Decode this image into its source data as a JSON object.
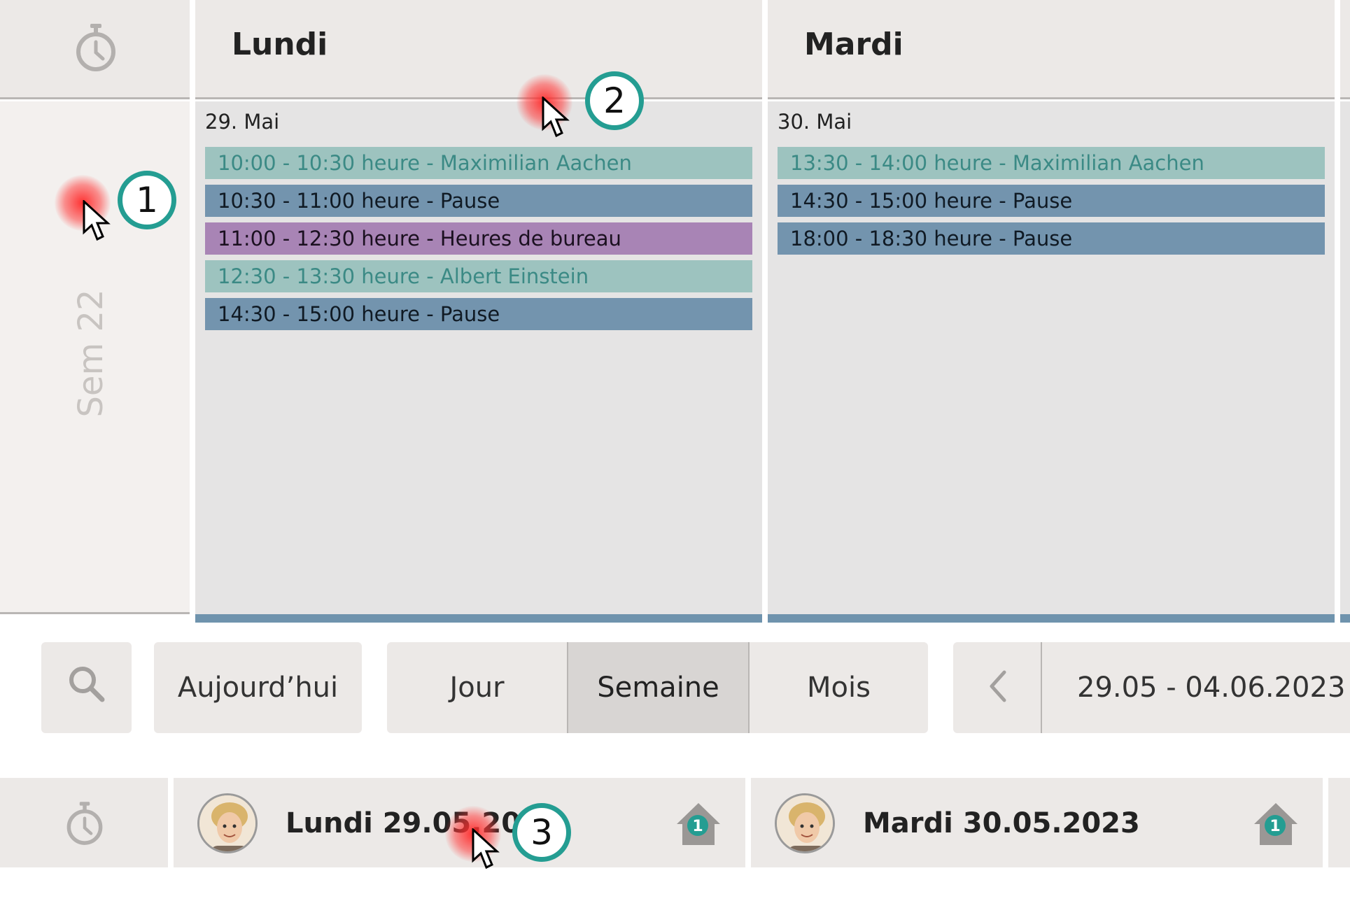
{
  "week": {
    "label": "Sem 22"
  },
  "days": [
    {
      "name": "Lundi",
      "date": "29. Mai",
      "events": [
        {
          "text": "10:00 - 10:30 heure - Maximilian Aachen",
          "kind": "apt"
        },
        {
          "text": "10:30 - 11:00 heure - Pause",
          "kind": "pause"
        },
        {
          "text": "11:00 - 12:30 heure - Heures de bureau",
          "kind": "office"
        },
        {
          "text": "12:30 - 13:30 heure - Albert Einstein",
          "kind": "apt"
        },
        {
          "text": "14:30 - 15:00 heure - Pause",
          "kind": "pause"
        }
      ]
    },
    {
      "name": "Mardi",
      "date": "30. Mai",
      "events": [
        {
          "text": "13:30 - 14:00 heure - Maximilian Aachen",
          "kind": "apt"
        },
        {
          "text": "14:30 - 15:00 heure - Pause",
          "kind": "pause"
        },
        {
          "text": "18:00 - 18:30 heure - Pause",
          "kind": "pause"
        }
      ]
    }
  ],
  "toolbar": {
    "search_icon": "search-icon",
    "today_label": "Aujourd’hui",
    "views": {
      "day": "Jour",
      "week": "Semaine",
      "month": "Mois"
    },
    "active_view": "Semaine",
    "prev_icon": "chevron-left-icon",
    "range": "29.05 - 04.06.2023"
  },
  "bottom": {
    "timer_icon": "stopwatch-icon",
    "days": [
      {
        "label": "Lundi 29.05.2023",
        "badge": "1"
      },
      {
        "label": "Mardi 30.05.2023",
        "badge": "1"
      }
    ]
  },
  "annotations": [
    "1",
    "2",
    "3"
  ],
  "colors": {
    "appointment_bg": "#9dc3bf",
    "appointment_text": "#3b8a85",
    "pause_bg": "#7394ae",
    "office_bg": "#a884b5",
    "badge_ring": "#249d92",
    "header_bg": "#ece9e7"
  }
}
